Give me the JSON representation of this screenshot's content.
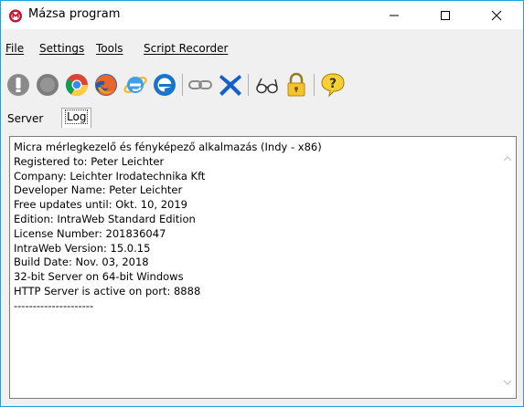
{
  "window": {
    "title": "Mázsa program"
  },
  "menu": {
    "file": "File",
    "settings": "Settings",
    "tools": "Tools",
    "script_recorder": "Script Recorder"
  },
  "toolbar": {
    "icons": [
      "power-icon",
      "stop-icon",
      "chrome-icon",
      "firefox-icon",
      "ie-icon",
      "edge-icon",
      "link-icon",
      "delete-icon",
      "glasses-icon",
      "lock-icon",
      "help-icon"
    ]
  },
  "tabs": {
    "server": "Server",
    "log": "Log",
    "active": "Log"
  },
  "log": {
    "lines": [
      "Micra mérlegkezelő és fényképező alkalmazás (Indy - x86)",
      "Registered to: Peter Leichter",
      "Company: Leichter Irodatechnika Kft",
      "Developer Name: Peter Leichter",
      "Free updates until: Okt. 10, 2019",
      "Edition: IntraWeb Standard Edition",
      "License Number: 201836047",
      "IntraWeb Version: 15.0.15",
      "Build Date: Nov. 03, 2018",
      "32-bit Server on 64-bit Windows",
      "HTTP Server is active on port: 8888",
      "---------------------"
    ]
  },
  "colors": {
    "window_border": "#18a2e0",
    "panel_bg": "#ffffff",
    "chrome_bg": "#f0f0f0"
  }
}
